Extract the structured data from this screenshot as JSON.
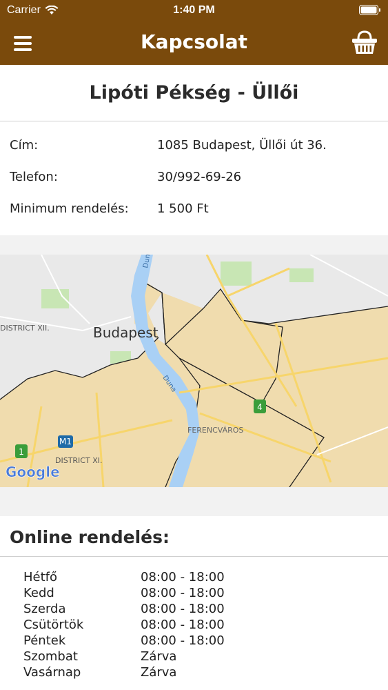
{
  "status_bar": {
    "carrier": "Carrier",
    "time": "1:40 PM"
  },
  "nav": {
    "title": "Kapcsolat",
    "menu_icon": "hamburger-menu-icon",
    "cart_icon": "basket-icon"
  },
  "shop": {
    "name": "Lipóti Pékség - Üllői",
    "info": [
      {
        "label": "Cím:",
        "value": "1085 Budapest, Üllői út 36."
      },
      {
        "label": "Telefon:",
        "value": "30/992-69-26"
      },
      {
        "label": "Minimum rendelés:",
        "value": "1 500 Ft"
      }
    ]
  },
  "map": {
    "labels": {
      "city": "Budapest",
      "district12": "DISTRICT XII.",
      "district11": "DISTRICT XI.",
      "ferencvaros": "FERENCVÁROS",
      "duna_top": "Duna",
      "duna_mid": "Duna",
      "m1": "M1",
      "route1": "1",
      "route4": "4",
      "google": "Google"
    },
    "colors": {
      "zone": "#f0dcae",
      "water": "#a9d0f5",
      "road": "#f7d56b",
      "park": "#c8e6b4"
    }
  },
  "online": {
    "title": "Online rendelés:",
    "hours": [
      {
        "day": "Hétfő",
        "time": "08:00 - 18:00"
      },
      {
        "day": "Kedd",
        "time": "08:00 - 18:00"
      },
      {
        "day": "Szerda",
        "time": "08:00 - 18:00"
      },
      {
        "day": "Csütörtök",
        "time": "08:00 - 18:00"
      },
      {
        "day": "Péntek",
        "time": "08:00 - 18:00"
      },
      {
        "day": "Szombat",
        "time": "Zárva"
      },
      {
        "day": "Vasárnap",
        "time": "Zárva"
      }
    ]
  },
  "theme": {
    "brand": "#7a4a0c"
  }
}
